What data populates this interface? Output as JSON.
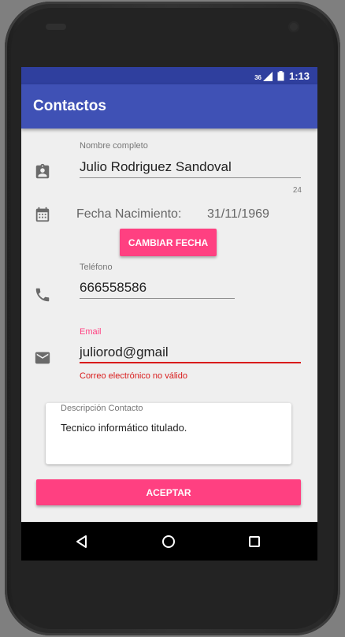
{
  "status_bar": {
    "signal": "36",
    "time": "1:13"
  },
  "app_bar": {
    "title": "Contactos"
  },
  "form": {
    "name": {
      "label": "Nombre completo",
      "value": "Julio Rodriguez Sandoval",
      "counter": "24"
    },
    "birth_date": {
      "label": "Fecha Nacimiento:",
      "value": "31/11/1969",
      "change_button": "CAMBIAR FECHA"
    },
    "phone": {
      "label": "Teléfono",
      "value": "666558586"
    },
    "email": {
      "label": "Email",
      "value": "juliorod@gmail",
      "error": "Correo electrónico no válido"
    },
    "description": {
      "label": "Descripción Contacto",
      "value": "Tecnico informático titulado."
    },
    "accept_button": "ACEPTAR"
  },
  "colors": {
    "primary": "#3f51b5",
    "primary_dark": "#2f3f9e",
    "accent": "#ff4081",
    "error": "#d81b1b"
  },
  "icons": [
    "contact-card-icon",
    "calendar-icon",
    "phone-icon",
    "email-icon",
    "back-icon",
    "home-icon",
    "recents-icon"
  ]
}
